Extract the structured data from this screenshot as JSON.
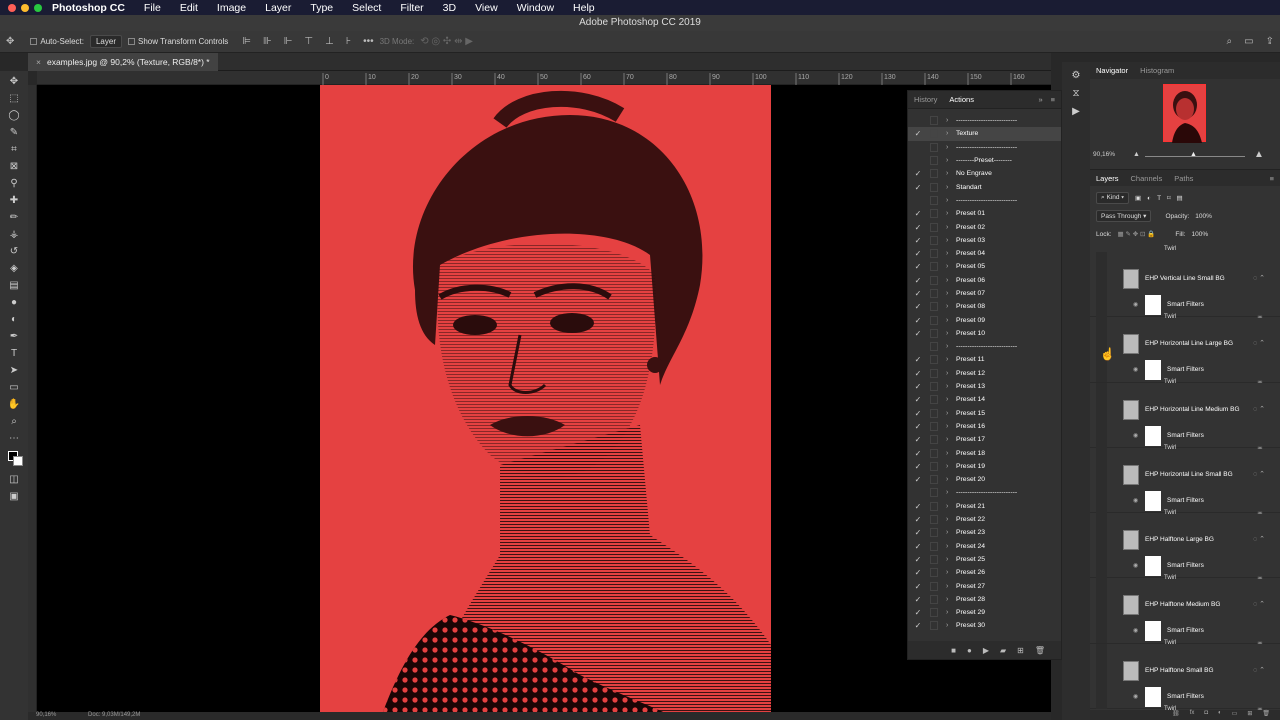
{
  "menubar": {
    "app_name": "Photoshop CC",
    "items": [
      "File",
      "Edit",
      "Image",
      "Layer",
      "Type",
      "Select",
      "Filter",
      "3D",
      "View",
      "Window",
      "Help"
    ],
    "traffic_colors": [
      "#ff5f57",
      "#febc2e",
      "#28c840"
    ]
  },
  "window": {
    "title": "Adobe Photoshop CC 2019"
  },
  "options": {
    "auto_select_label": "Auto-Select:",
    "auto_select_value": "Layer",
    "transform_label": "Show Transform Controls",
    "mode_3d_label": "3D Mode:"
  },
  "document": {
    "tab_title": "examples.jpg @ 90,2% (Texture, RGB/8*) *",
    "status_zoom": "90,16%",
    "status_doc": "Doc: 9,03M/149,2M",
    "canvas_color": "#e54141"
  },
  "ruler": {
    "top_ticks": [
      "0",
      "10",
      "20",
      "30",
      "40",
      "50",
      "60",
      "70",
      "80",
      "90",
      "100",
      "110",
      "120",
      "130",
      "140",
      "150",
      "160",
      "170"
    ]
  },
  "toolbar": {
    "icons": [
      "move-icon",
      "marquee-icon",
      "lasso-icon",
      "quick-select-icon",
      "crop-icon",
      "frame-icon",
      "eyedropper-icon",
      "healing-icon",
      "brush-icon",
      "stamp-icon",
      "history-brush-icon",
      "eraser-icon",
      "gradient-icon",
      "blur-icon",
      "dodge-icon",
      "pen-icon",
      "type-icon",
      "path-select-icon",
      "rectangle-icon",
      "hand-icon",
      "zoom-icon",
      "more-icon"
    ]
  },
  "actions_panel": {
    "tabs": [
      "History",
      "Actions"
    ],
    "active_tab": "Actions",
    "rows": [
      {
        "label": "---------------------------",
        "checked": false
      },
      {
        "label": "Texture",
        "checked": true,
        "selected": true
      },
      {
        "label": "---------------------------",
        "checked": false
      },
      {
        "label": "--------Preset--------",
        "checked": false
      },
      {
        "label": "No Engrave",
        "checked": true
      },
      {
        "label": "Standart",
        "checked": true
      },
      {
        "label": "---------------------------",
        "checked": false
      },
      {
        "label": "Preset 01",
        "checked": true
      },
      {
        "label": "Preset 02",
        "checked": true
      },
      {
        "label": "Preset 03",
        "checked": true
      },
      {
        "label": "Preset 04",
        "checked": true
      },
      {
        "label": "Preset 05",
        "checked": true
      },
      {
        "label": "Preset 06",
        "checked": true
      },
      {
        "label": "Preset 07",
        "checked": true
      },
      {
        "label": "Preset 08",
        "checked": true
      },
      {
        "label": "Preset 09",
        "checked": true
      },
      {
        "label": "Preset 10",
        "checked": true
      },
      {
        "label": "---------------------------",
        "checked": false
      },
      {
        "label": "Preset 11",
        "checked": true
      },
      {
        "label": "Preset 12",
        "checked": true
      },
      {
        "label": "Preset 13",
        "checked": true
      },
      {
        "label": "Preset 14",
        "checked": true
      },
      {
        "label": "Preset 15",
        "checked": true
      },
      {
        "label": "Preset 16",
        "checked": true
      },
      {
        "label": "Preset 17",
        "checked": true
      },
      {
        "label": "Preset 18",
        "checked": true
      },
      {
        "label": "Preset 19",
        "checked": true
      },
      {
        "label": "Preset 20",
        "checked": true
      },
      {
        "label": "---------------------------",
        "checked": false
      },
      {
        "label": "Preset 21",
        "checked": true
      },
      {
        "label": "Preset 22",
        "checked": true
      },
      {
        "label": "Preset 23",
        "checked": true
      },
      {
        "label": "Preset 24",
        "checked": true
      },
      {
        "label": "Preset 25",
        "checked": true
      },
      {
        "label": "Preset 26",
        "checked": true
      },
      {
        "label": "Preset 27",
        "checked": true
      },
      {
        "label": "Preset 28",
        "checked": true
      },
      {
        "label": "Preset 29",
        "checked": true
      },
      {
        "label": "Preset 30",
        "checked": true
      }
    ]
  },
  "navigator": {
    "tabs": [
      "Navigator",
      "Histogram"
    ],
    "zoom": "90,16%"
  },
  "layers_panel": {
    "tabs": [
      "Layers",
      "Channels",
      "Paths"
    ],
    "filter": "Kind",
    "blend_mode": "Pass Through",
    "opacity_label": "Opacity:",
    "opacity": "100%",
    "lock_label": "Lock:",
    "fill_label": "Fill:",
    "fill": "100%",
    "top_twirl": "Twirl",
    "layers": [
      {
        "name": "EHP Vertical Line Small BG",
        "smart_filters": "Smart Filters",
        "twirl": "Twirl"
      },
      {
        "name": "EHP Horizontal Line Large BG",
        "smart_filters": "Smart Filters",
        "twirl": "Twirl"
      },
      {
        "name": "EHP Horizontal Line Medium BG",
        "smart_filters": "Smart Filters",
        "twirl": "Twirl"
      },
      {
        "name": "EHP Horizontal Line Small BG",
        "smart_filters": "Smart Filters",
        "twirl": "Twirl"
      },
      {
        "name": "EHP Halftone Large BG",
        "smart_filters": "Smart Filters",
        "twirl": "Twirl"
      },
      {
        "name": "EHP Halftone Medium BG",
        "smart_filters": "Smart Filters",
        "twirl": "Twirl"
      },
      {
        "name": "EHP Halftone Small BG",
        "smart_filters": "Smart Filters",
        "twirl": "Twirl"
      }
    ]
  }
}
